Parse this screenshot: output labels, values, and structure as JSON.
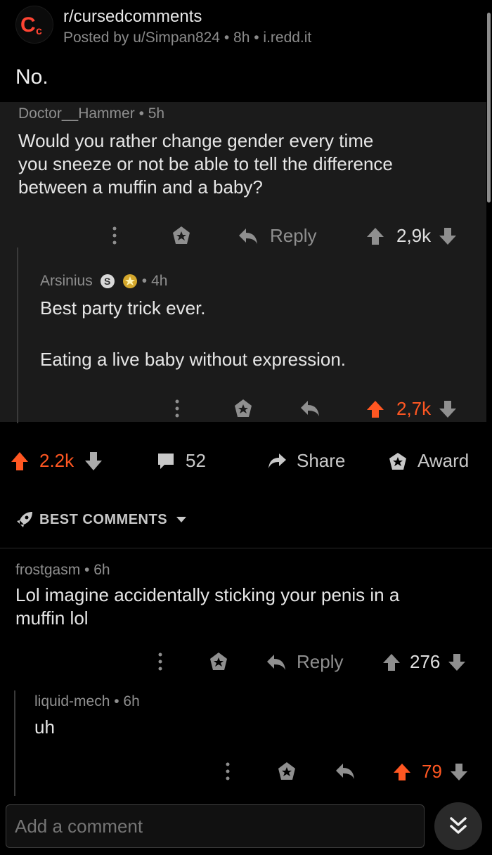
{
  "post": {
    "subreddit": "r/cursedcomments",
    "posted_by": "Posted by u/Simpan824",
    "age": "8h",
    "domain": "i.redd.it",
    "title": "No."
  },
  "embedded": {
    "comment1": {
      "author": "Doctor__Hammer",
      "age": "5h",
      "body_lines": [
        "Would you rather change gender every time",
        "you sneeze or not be able to tell the difference",
        "between a muffin and a baby?"
      ],
      "reply_label": "Reply",
      "score": "2,9k"
    },
    "comment2": {
      "author": "Arsinius",
      "age": "4h",
      "body_lines": [
        "Best party trick ever.",
        "Eating a live baby without expression."
      ],
      "score": "2,7k"
    }
  },
  "post_actions": {
    "score": "2.2k",
    "comments": "52",
    "share": "Share",
    "award": "Award"
  },
  "sort": {
    "label": "BEST COMMENTS"
  },
  "comments": [
    {
      "author": "frostgasm",
      "age": "6h",
      "body_lines": [
        "Lol imagine accidentally sticking your penis in a",
        "muffin lol"
      ],
      "reply_label": "Reply",
      "score": "276"
    },
    {
      "author": "liquid-mech",
      "age": "6h",
      "body": "uh",
      "score": "79"
    }
  ],
  "composer": {
    "placeholder": "Add a comment"
  },
  "colors": {
    "accent": "#ff5722",
    "background": "#000000",
    "embed_bg": "#1b1b1b"
  }
}
